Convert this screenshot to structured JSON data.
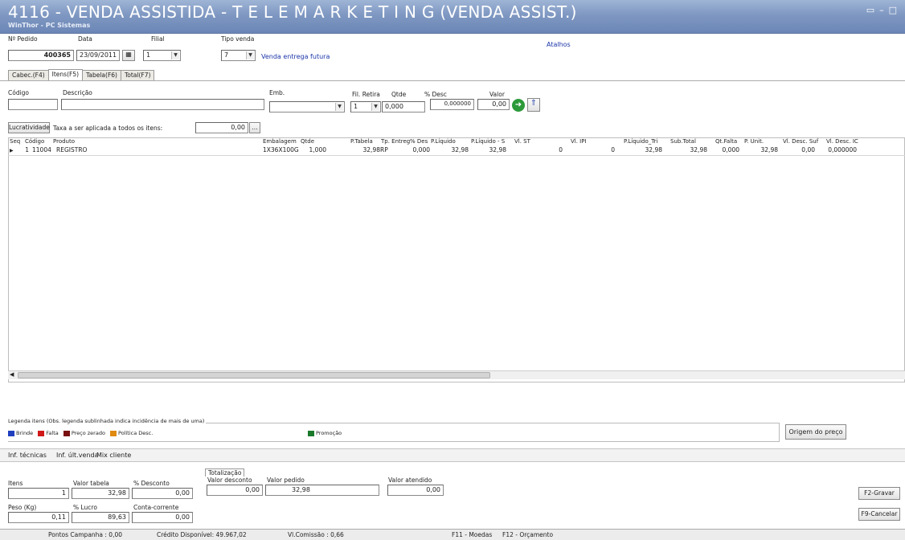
{
  "window": {
    "title": "4116 - VENDA ASSISTIDA - T E L E M A R K E T I N G  (VENDA ASSIST.)",
    "subtitle": "WinThor - PC Sistemas"
  },
  "header": {
    "pedido_label": "Nº Pedido",
    "pedido_value": "400365",
    "data_label": "Data",
    "data_value": "23/09/2011",
    "filial_label": "Filial",
    "filial_value": "1",
    "tipo_venda_label": "Tipo venda",
    "tipo_venda_value": "7",
    "tipo_venda_desc": "Venda entrega futura",
    "atalhos_link": "Atalhos"
  },
  "tabs": [
    "Cabec.(F4)",
    "Itens(F5)",
    "Tabela(F6)",
    "Total(F7)"
  ],
  "item_entry": {
    "codigo_label": "Código",
    "descricao_label": "Descrição",
    "emb_label": "Emb.",
    "fil_retira_label": "Fil. Retira",
    "fil_retira_value": "1",
    "qtde_label": "Qtde",
    "qtde_value": "0,000",
    "desc_label": "% Desc",
    "desc_value": "0,000000",
    "valor_label": "Valor",
    "valor_value": "0,00"
  },
  "lucratividade": {
    "button": "Lucratividade",
    "taxa_label": "Taxa a ser aplicada a todos os itens:",
    "taxa_value": "0,00",
    "ellipsis": "..."
  },
  "grid": {
    "columns": [
      "Seq",
      "Código",
      "Produto",
      "Embalagem",
      "Qtde",
      "P.Tabela",
      "Tp. Entreg",
      "% Des",
      "P.Líquido",
      "P.Líquido - S",
      "Vl. ST",
      "Vl. IPI",
      "P.Líquido_Tri",
      "Sub.Total",
      "Qt.Falta",
      "P. Unit.",
      "Vl. Desc. Suf",
      "Vl. Desc. IC"
    ],
    "rows": [
      [
        "1",
        "11004",
        "REGISTRO",
        "1X36X100G",
        "1,000",
        "32,98",
        "RP",
        "0,000",
        "32,98",
        "32,98",
        "0",
        "0",
        "32,98",
        "32,98",
        "0,000",
        "32,98",
        "0,00",
        "0,000000"
      ]
    ]
  },
  "legend": {
    "title": "Legenda itens (Obs. legenda sublinhada indica incidência de mais de uma)",
    "items": [
      {
        "label": "Brinde",
        "color": "#1f3fbf"
      },
      {
        "label": "Falta",
        "color": "#d01818"
      },
      {
        "label": "Preço zerado",
        "color": "#7a1010"
      },
      {
        "label": "Política Desc.",
        "color": "#e08a10"
      },
      {
        "label": "Promoção",
        "color": "#1a7a2a"
      }
    ],
    "origem_button": "Origem do preço"
  },
  "info_tabs": [
    "Inf. técnicas",
    "Inf. últ.venda",
    "Mix cliente"
  ],
  "totals": {
    "section_title": "Totalização",
    "itens_label": "Itens",
    "itens_value": "1",
    "valor_tabela_label": "Valor tabela",
    "valor_tabela_value": "32,98",
    "pct_desconto_label": "% Desconto",
    "pct_desconto_value": "0,00",
    "valor_desconto_label": "Valor desconto",
    "valor_desconto_value": "0,00",
    "valor_pedido_label": "Valor pedido",
    "valor_pedido_value": "32,98",
    "valor_atendido_label": "Valor atendido",
    "valor_atendido_value": "0,00",
    "peso_label": "Peso (Kg)",
    "peso_value": "0,11",
    "lucro_label": "% Lucro",
    "lucro_value": "89,63",
    "conta_label": "Conta-corrente",
    "conta_value": "0,00"
  },
  "actions": {
    "gravar": "F2-Gravar",
    "cancelar": "F9-Cancelar"
  },
  "status": {
    "pontos": "Pontos Campanha : 0,00",
    "credito": "Crédito Disponível: 49.967,02",
    "comissao": "Vl.Comissão : 0,66",
    "moedas": "F11 - Moedas",
    "orcamento": "F12 - Orçamento"
  }
}
